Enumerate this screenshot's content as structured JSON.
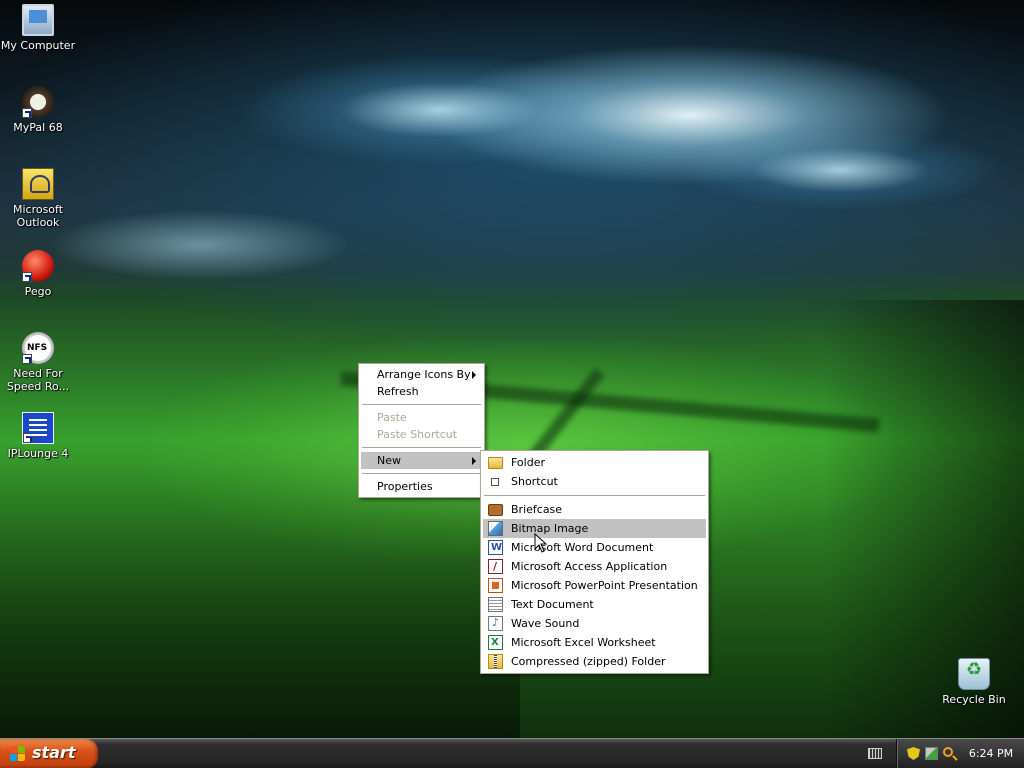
{
  "desktop": {
    "icons": [
      {
        "label": "My Computer",
        "icon": "computer-icon"
      },
      {
        "label": "MyPal 68",
        "icon": "mypal-icon",
        "shortcut": true
      },
      {
        "label": "Microsoft Outlook",
        "icon": "outlook-icon"
      },
      {
        "label": "Pego",
        "icon": "pego-icon",
        "shortcut": true
      },
      {
        "label": "Need For Speed Ro...",
        "icon": "nfs-icon",
        "shortcut": true
      },
      {
        "label": "IPLounge 4",
        "icon": "iplounge-icon",
        "shortcut": true
      }
    ],
    "recycle_bin": {
      "label": "Recycle Bin",
      "icon": "recycle-bin-icon"
    }
  },
  "context_menu": {
    "items": [
      {
        "label": "Arrange Icons By",
        "submenu": true
      },
      {
        "label": "Refresh"
      },
      {
        "label": "Paste",
        "disabled": true
      },
      {
        "label": "Paste Shortcut",
        "disabled": true
      },
      {
        "label": "New",
        "submenu": true,
        "highlighted": true
      },
      {
        "label": "Properties"
      }
    ]
  },
  "new_submenu": {
    "items": [
      {
        "label": "Folder",
        "icon": "folder-icon"
      },
      {
        "label": "Shortcut",
        "icon": "shortcut-icon"
      },
      {
        "label": "Briefcase",
        "icon": "briefcase-icon"
      },
      {
        "label": "Bitmap Image",
        "icon": "bitmap-image-icon",
        "highlighted": true
      },
      {
        "label": "Microsoft Word Document",
        "icon": "word-document-icon"
      },
      {
        "label": "Microsoft Access Application",
        "icon": "access-application-icon"
      },
      {
        "label": "Microsoft PowerPoint Presentation",
        "icon": "powerpoint-presentation-icon"
      },
      {
        "label": "Text Document",
        "icon": "text-document-icon"
      },
      {
        "label": "Wave Sound",
        "icon": "wave-sound-icon"
      },
      {
        "label": "Microsoft Excel Worksheet",
        "icon": "excel-worksheet-icon"
      },
      {
        "label": "Compressed (zipped) Folder",
        "icon": "zipped-folder-icon"
      }
    ]
  },
  "taskbar": {
    "start_label": "start",
    "clock": "6:24 PM",
    "tray_icons": [
      "keyboard-icon",
      "security-shield-icon",
      "network-icon",
      "search-icon"
    ]
  },
  "colors": {
    "menu_highlight": "#c1c1c1",
    "disabled_text": "#aca899",
    "start_button": "#d8521a",
    "taskbar": "#262626"
  }
}
